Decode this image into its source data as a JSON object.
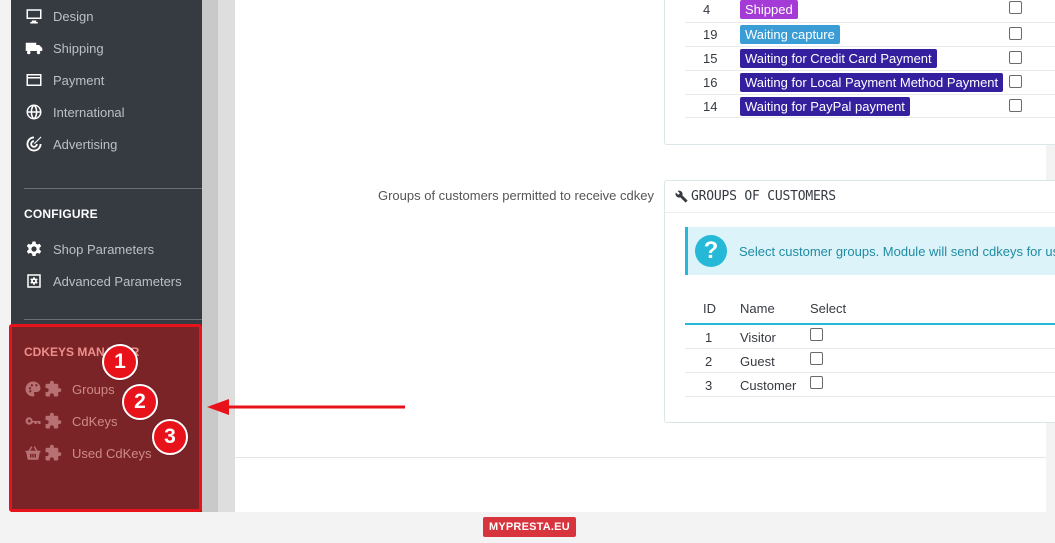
{
  "sidebar": {
    "items": [
      {
        "label": "Design",
        "icon": "desktop-icon"
      },
      {
        "label": "Shipping",
        "icon": "truck-icon"
      },
      {
        "label": "Payment",
        "icon": "credit-card-icon"
      },
      {
        "label": "International",
        "icon": "globe-icon"
      },
      {
        "label": "Advertising",
        "icon": "target-icon"
      }
    ],
    "configure_title": "CONFIGURE",
    "configure_items": [
      {
        "label": "Shop Parameters",
        "icon": "gear-icon"
      },
      {
        "label": "Advanced Parameters",
        "icon": "settings-box-icon"
      }
    ],
    "cdkeys_title": "CDKEYS MANAGER",
    "cdkeys_items": [
      {
        "label": "Groups",
        "icon": "palette-icon"
      },
      {
        "label": "CdKeys",
        "icon": "key-icon"
      },
      {
        "label": "Used CdKeys",
        "icon": "basket-icon"
      }
    ],
    "badges": [
      "1",
      "2",
      "3"
    ],
    "highlight_color": "#e8131a"
  },
  "order_statuses": {
    "rows": [
      {
        "id": "4",
        "label": "Shipped",
        "color": "#a53bd6"
      },
      {
        "id": "19",
        "label": "Waiting capture",
        "color": "#3b9dd6"
      },
      {
        "id": "15",
        "label": "Waiting for Credit Card Payment",
        "color": "#34209e"
      },
      {
        "id": "16",
        "label": "Waiting for Local Payment Method Payment",
        "color": "#34209e"
      },
      {
        "id": "14",
        "label": "Waiting for PayPal payment",
        "color": "#34209e"
      }
    ]
  },
  "groups": {
    "field_label": "Groups of customers permitted to receive cdkey",
    "panel_title": "GROUPS OF CUSTOMERS",
    "alert_text": "Select customer groups. Module will send cdkeys for us",
    "columns": [
      "ID",
      "Name",
      "Select"
    ],
    "rows": [
      {
        "id": "1",
        "name": "Visitor"
      },
      {
        "id": "2",
        "name": "Guest"
      },
      {
        "id": "3",
        "name": "Customer"
      }
    ]
  },
  "footer": {
    "brand": "MYPRESTA.EU"
  }
}
